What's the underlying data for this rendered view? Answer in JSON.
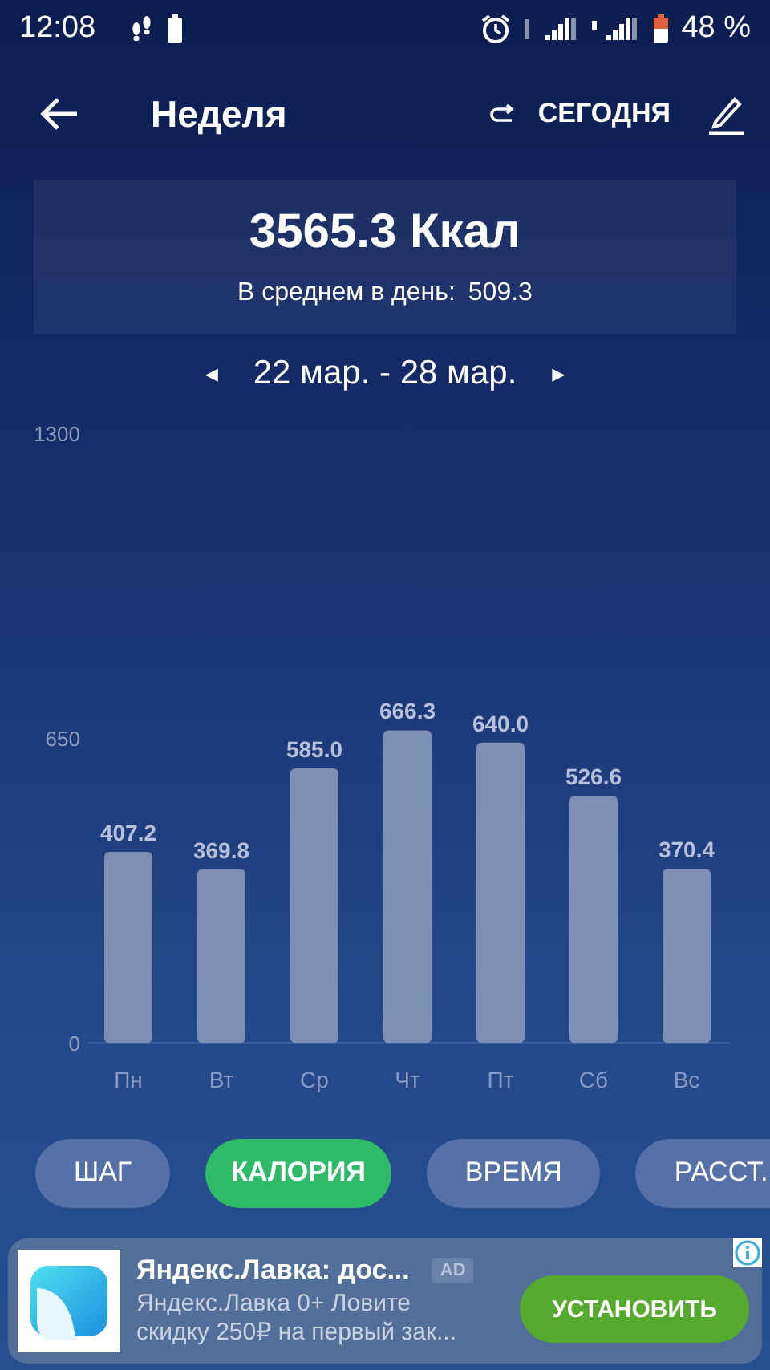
{
  "status_bar": {
    "time": "12:08",
    "battery": "48 %"
  },
  "app_bar": {
    "title": "Неделя",
    "today": "СЕГОДНЯ"
  },
  "summary": {
    "total": "3565.3 Ккал",
    "average_label": "В среднем в день:",
    "average_value": "509.3"
  },
  "period": {
    "prev": "◂",
    "label": "22 мар. - 28 мар.",
    "next": "▸"
  },
  "chart_data": {
    "type": "bar",
    "categories": [
      "Пн",
      "Вт",
      "Ср",
      "Чт",
      "Пт",
      "Сб",
      "Вс"
    ],
    "values": [
      407.2,
      369.8,
      585.0,
      666.3,
      640.0,
      526.6,
      370.4
    ],
    "value_labels": [
      "407.2",
      "369.8",
      "585.0",
      "666.3",
      "640.0",
      "526.6",
      "370.4"
    ],
    "ylim": [
      0,
      1300
    ],
    "yticks": [
      0,
      650,
      1300
    ]
  },
  "tabs": [
    {
      "label": "ШАГ",
      "selected": false
    },
    {
      "label": "КАЛОРИЯ",
      "selected": true
    },
    {
      "label": "ВРЕМЯ",
      "selected": false
    },
    {
      "label": "РАССТ.",
      "selected": false
    }
  ],
  "ad": {
    "title": "Яндекс.Лавка: дос...",
    "badge": "AD",
    "description": "Яндекс.Лавка 0+ Ловите скидку 250₽ на первый зак...",
    "button": "УСТАНОВИТЬ"
  }
}
